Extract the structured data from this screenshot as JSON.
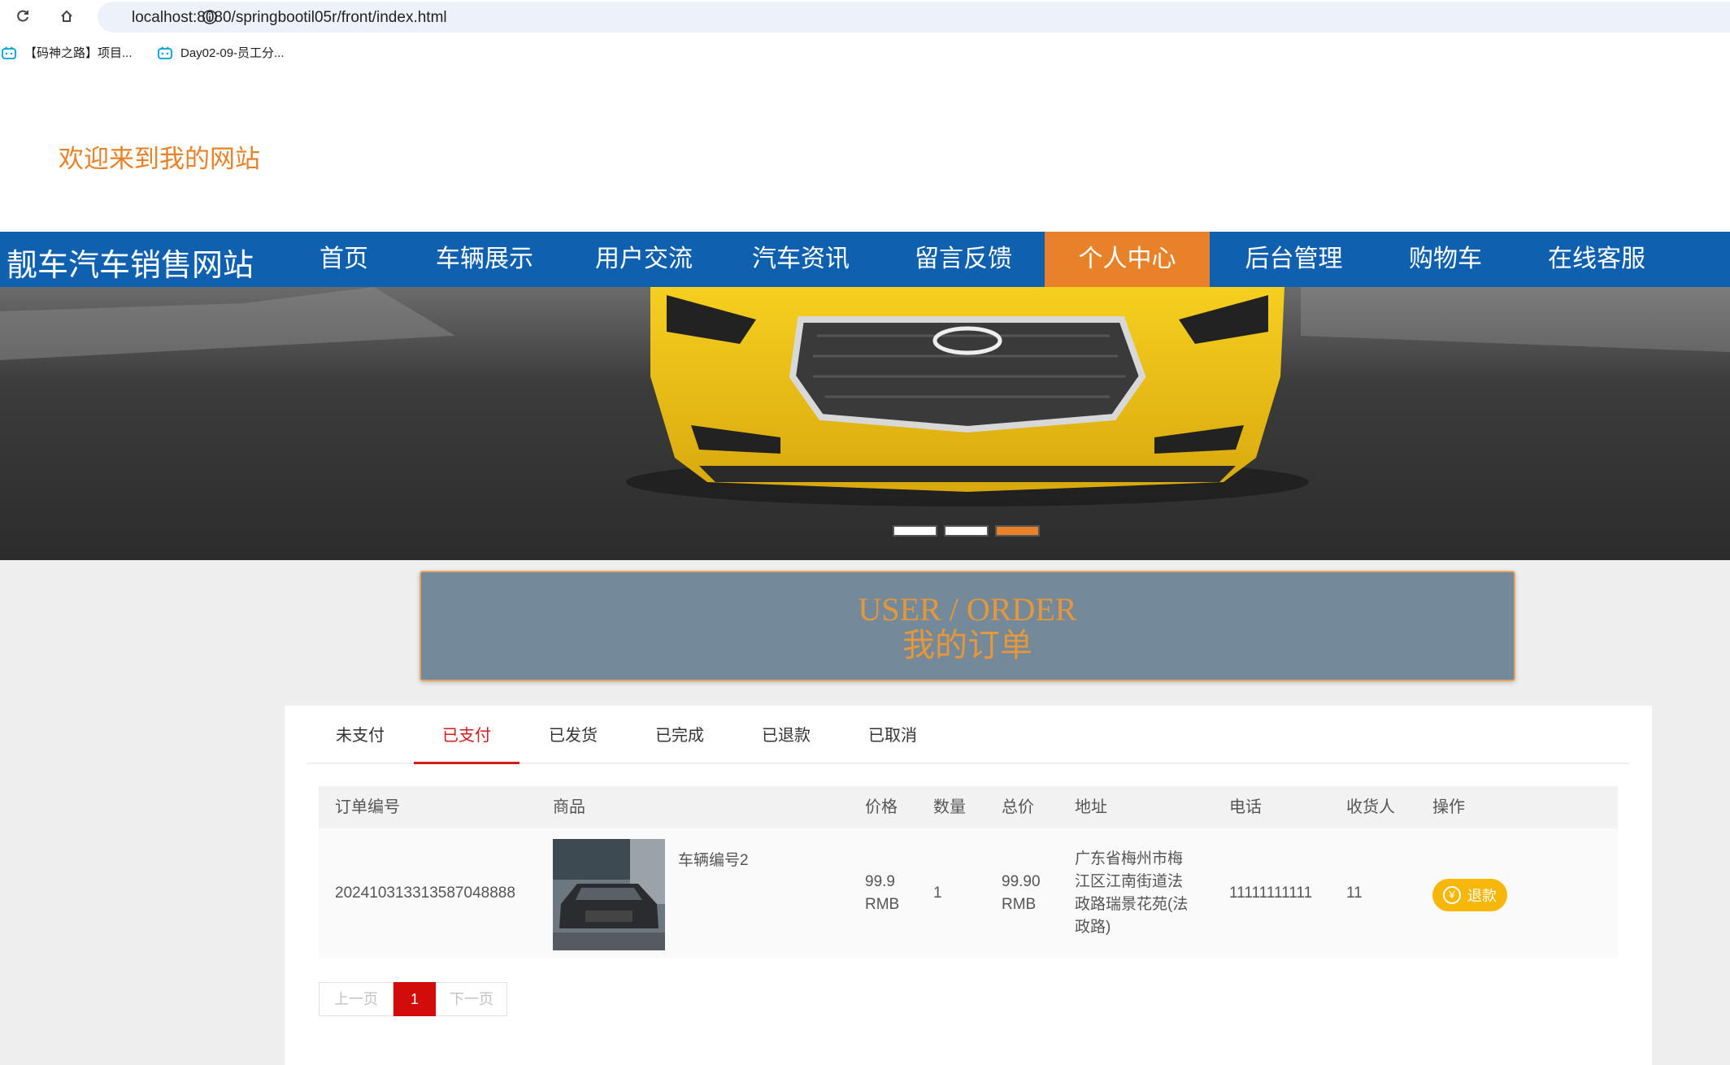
{
  "browser": {
    "url": "localhost:8080/springbootil05r/front/index.html",
    "bookmarks": [
      {
        "label": "【码神之路】项目..."
      },
      {
        "label": "Day02-09-员工分..."
      }
    ]
  },
  "site": {
    "welcome": "欢迎来到我的网站",
    "brand": "靓车汽车销售网站"
  },
  "nav": {
    "items": [
      {
        "label": "首页"
      },
      {
        "label": "车辆展示"
      },
      {
        "label": "用户交流"
      },
      {
        "label": "汽车资讯"
      },
      {
        "label": "留言反馈"
      },
      {
        "label": "个人中心"
      },
      {
        "label": "后台管理"
      },
      {
        "label": "购物车"
      },
      {
        "label": "在线客服"
      }
    ],
    "active": "个人中心"
  },
  "banner": {
    "slide_count": 3,
    "active_slide": 3
  },
  "section": {
    "title_en": "USER / ORDER",
    "title_cn": "我的订单"
  },
  "tabs": {
    "items": [
      {
        "label": "未支付"
      },
      {
        "label": "已支付"
      },
      {
        "label": "已发货"
      },
      {
        "label": "已完成"
      },
      {
        "label": "已退款"
      },
      {
        "label": "已取消"
      }
    ],
    "active": "已支付"
  },
  "table": {
    "headers": [
      "订单编号",
      "商品",
      "价格",
      "数量",
      "总价",
      "地址",
      "电话",
      "收货人",
      "操作"
    ],
    "rows": [
      {
        "order_no": "20241031331358704888 8",
        "order_no_display": "202410313313587048888",
        "product": "车辆编号2",
        "price_value": "99.9",
        "price_unit": "RMB",
        "quantity": "1",
        "total_value": "99.90",
        "total_unit": "RMB",
        "address_lines": [
          "广东省梅州市梅",
          "江区江南街道法",
          "政路瑞景花苑(法",
          "政路)"
        ],
        "phone": "11111111111",
        "receiver": "11",
        "action": "退款"
      }
    ]
  },
  "pagination": {
    "prev": "上一页",
    "current": "1",
    "next": "下一页"
  },
  "colors": {
    "nav_blue": "#1060b0",
    "accent_orange": "#e8822a",
    "active_tab_red": "#d21d1d",
    "refund_yellow": "#f6b709"
  }
}
